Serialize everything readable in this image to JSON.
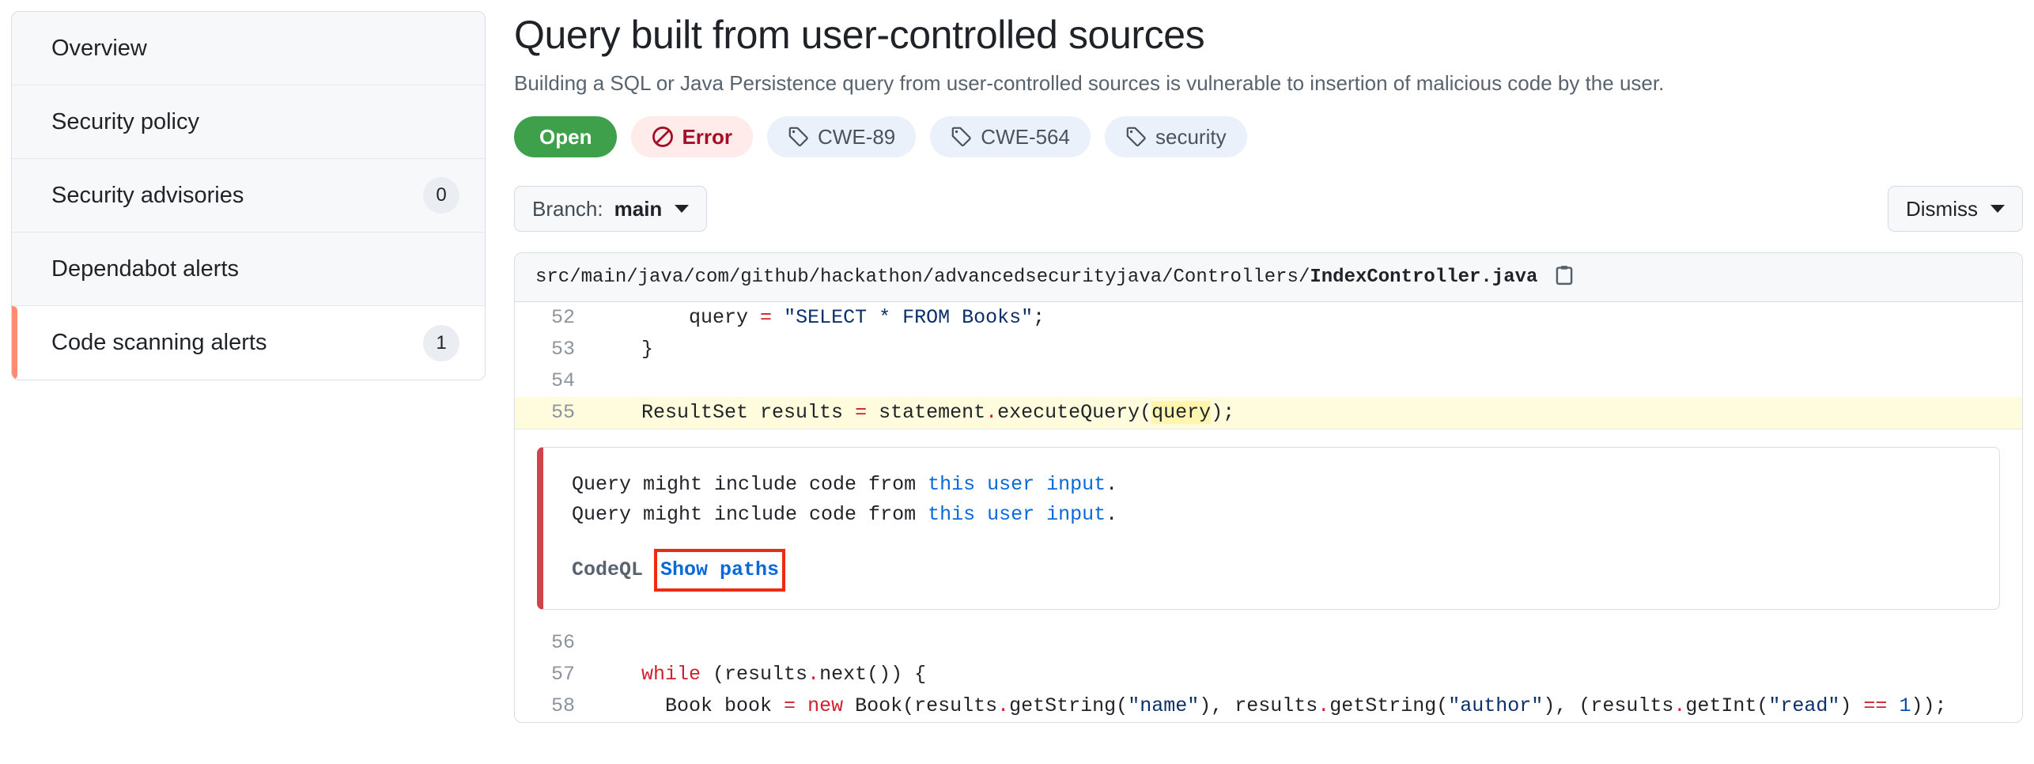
{
  "sidebar": {
    "items": [
      {
        "label": "Overview",
        "count": null,
        "active": false
      },
      {
        "label": "Security policy",
        "count": null,
        "active": false
      },
      {
        "label": "Security advisories",
        "count": "0",
        "active": false
      },
      {
        "label": "Dependabot alerts",
        "count": null,
        "active": false
      },
      {
        "label": "Code scanning alerts",
        "count": "1",
        "active": true
      }
    ]
  },
  "alert": {
    "title": "Query built from user-controlled sources",
    "description": "Building a SQL or Java Persistence query from user-controlled sources is vulnerable to insertion of malicious code by the user.",
    "badges": [
      {
        "label": "Open",
        "kind": "state-open",
        "icon": null
      },
      {
        "label": "Error",
        "kind": "severity-error",
        "icon": "no-entry-icon"
      },
      {
        "label": "CWE-89",
        "kind": "tag",
        "icon": "tag-icon"
      },
      {
        "label": "CWE-564",
        "kind": "tag",
        "icon": "tag-icon"
      },
      {
        "label": "security",
        "kind": "tag",
        "icon": "tag-icon"
      }
    ]
  },
  "toolbar": {
    "branch_prefix": "Branch:",
    "branch_name": "main",
    "dismiss_label": "Dismiss"
  },
  "code": {
    "path_prefix": "src/main/java/com/github/hackathon/advancedsecurityjava/Controllers/",
    "file_name": "IndexController.java",
    "copy_icon": "copy-icon",
    "lines_before": [
      {
        "number": "52",
        "text": "        query = \"SELECT * FROM Books\";"
      },
      {
        "number": "53",
        "text": "    }"
      },
      {
        "number": "54",
        "text": ""
      },
      {
        "number": "55",
        "text": "    ResultSet results = statement.executeQuery(query);",
        "highlighted": true
      }
    ],
    "lines_after": [
      {
        "number": "56",
        "text": ""
      },
      {
        "number": "57",
        "text": "    while (results.next()) {"
      },
      {
        "number": "58",
        "text": "      Book book = new Book(results.getString(\"name\"), results.getString(\"author\"), (results.getInt(\"read\") == 1));"
      }
    ]
  },
  "message": {
    "line1_prefix": "Query might include code from ",
    "line1_link": "this user input",
    "line1_suffix": ".",
    "line2_prefix": "Query might include code from ",
    "line2_link": "this user input",
    "line2_suffix": ".",
    "tool": "CodeQL",
    "show_paths_label": "Show paths"
  },
  "colors": {
    "open_green": "#3fa04b",
    "error_red": "#a40e26",
    "tag_blue_bg": "#eaf1fb",
    "active_accent": "#fd8c73",
    "link_blue": "#0969da",
    "highlight_row": "#fffbdd",
    "highlight_token": "#fff5b1",
    "annotation_red": "#ee2b11"
  }
}
